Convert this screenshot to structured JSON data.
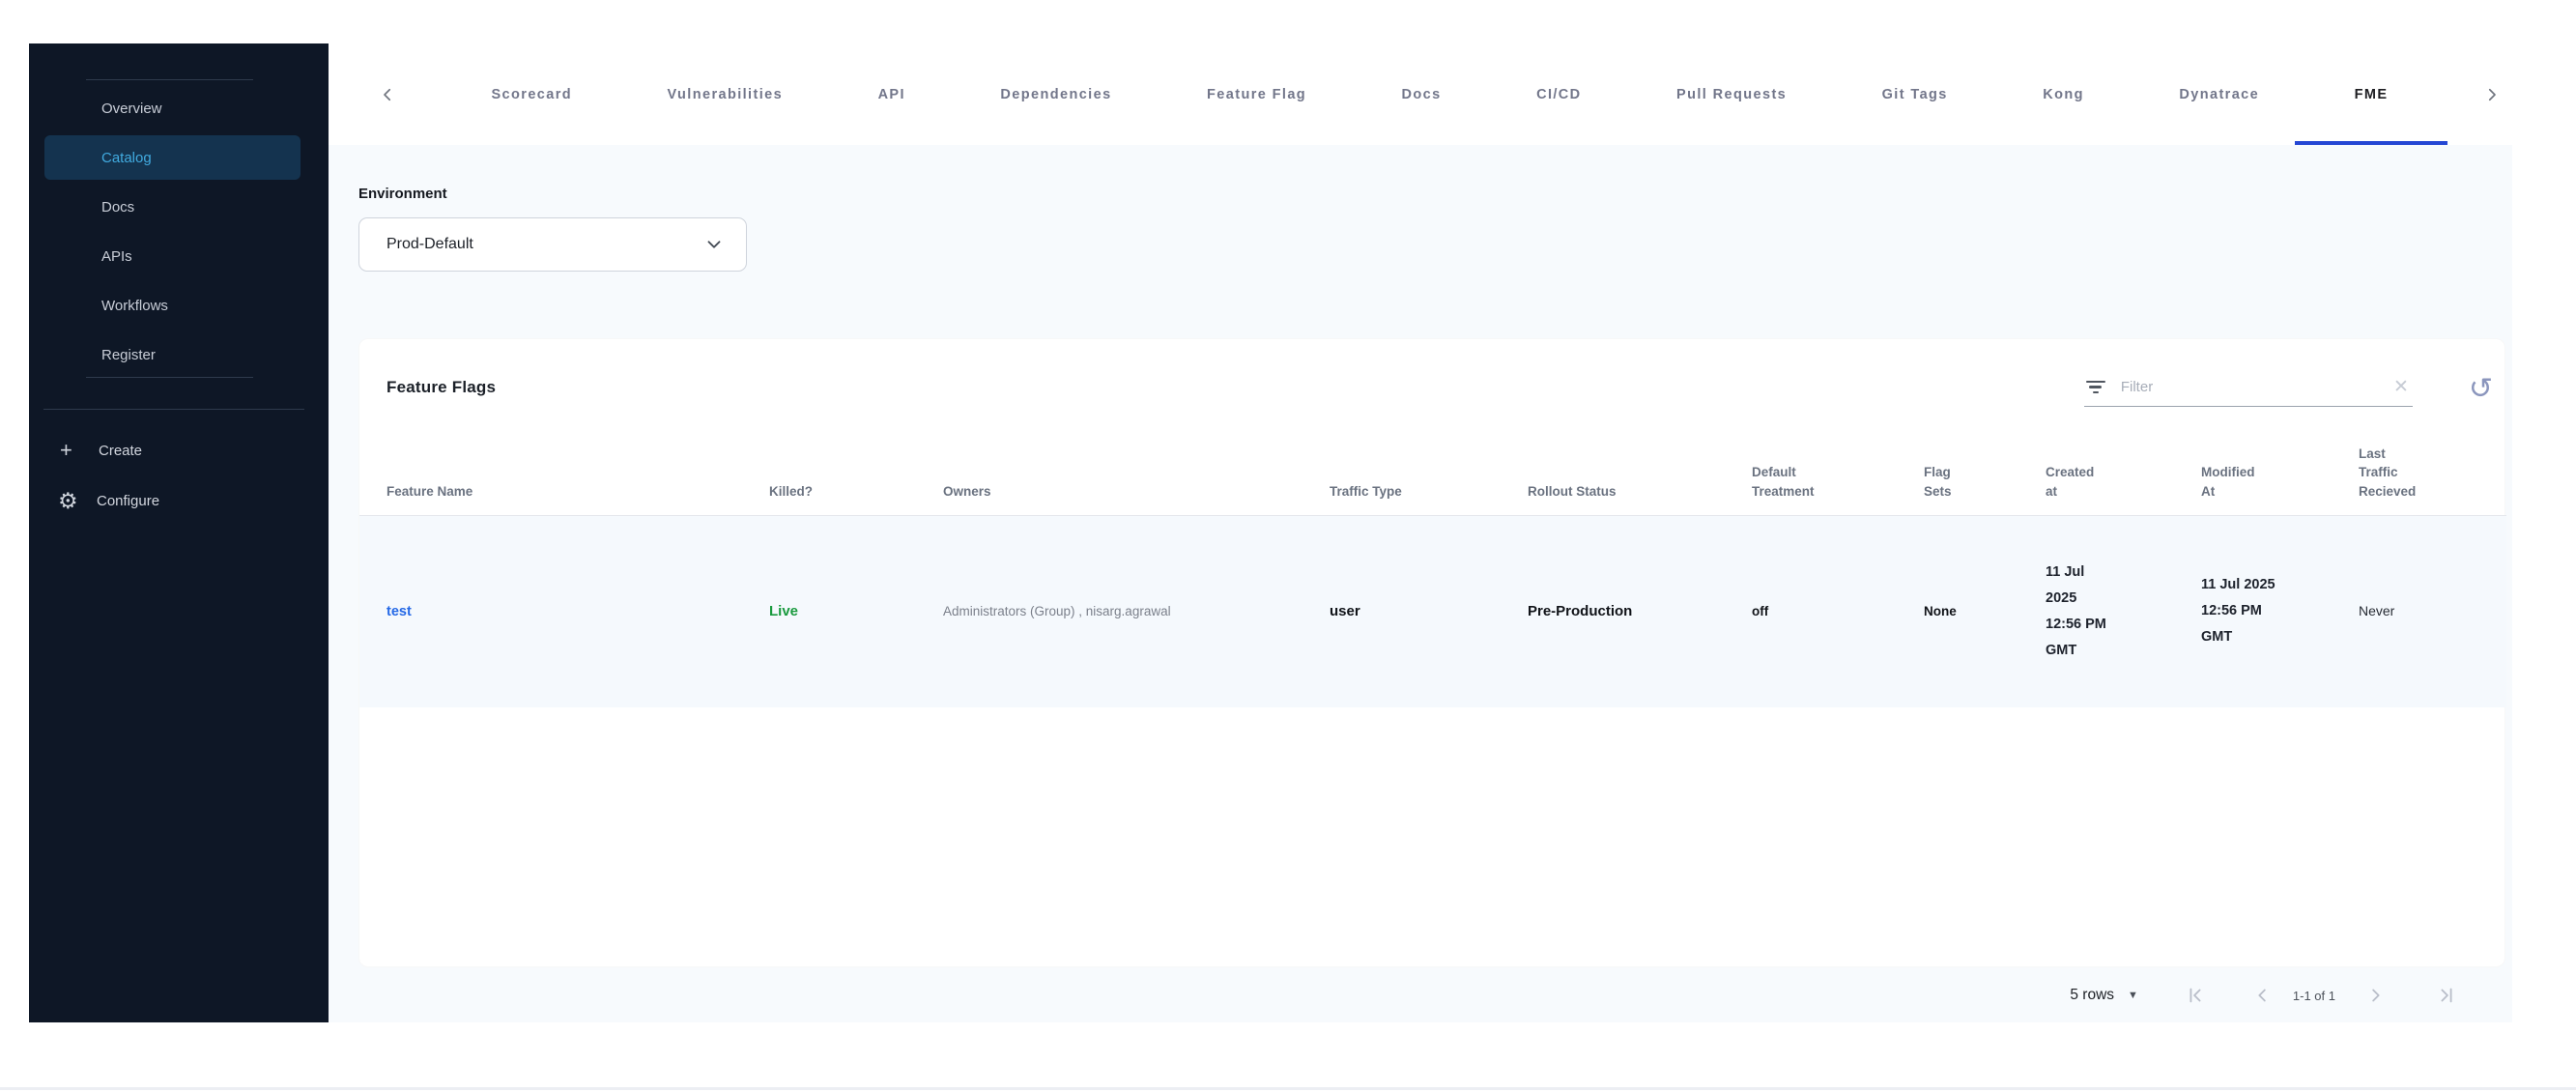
{
  "sidebar": {
    "items": [
      {
        "label": "Overview"
      },
      {
        "label": "Catalog"
      },
      {
        "label": "Docs"
      },
      {
        "label": "APIs"
      },
      {
        "label": "Workflows"
      },
      {
        "label": "Register"
      }
    ],
    "active_item": "Catalog",
    "create_label": "Create",
    "configure_label": "Configure"
  },
  "tabs": {
    "items": [
      {
        "label": "Scorecard"
      },
      {
        "label": "Vulnerabilities"
      },
      {
        "label": "API"
      },
      {
        "label": "Dependencies"
      },
      {
        "label": "Feature Flag"
      },
      {
        "label": "Docs"
      },
      {
        "label": "CI/CD"
      },
      {
        "label": "Pull Requests"
      },
      {
        "label": "Git Tags"
      },
      {
        "label": "Kong"
      },
      {
        "label": "Dynatrace"
      },
      {
        "label": "FME"
      }
    ],
    "active_tab": "FME"
  },
  "environment": {
    "label": "Environment",
    "value": "Prod-Default"
  },
  "card": {
    "title": "Feature Flags",
    "filter_placeholder": "Filter",
    "table": {
      "columns": [
        "Feature Name",
        "Killed?",
        "Owners",
        "Traffic Type",
        "Rollout Status",
        "Default Treatment",
        "Flag Sets",
        "Created at",
        "Modified At",
        "Last Traffic Recieved"
      ],
      "rows": [
        {
          "feature_name": "test",
          "killed": "Live",
          "owners": "Administrators (Group) , nisarg.agrawal",
          "traffic_type": "user",
          "rollout_status": "Pre-Production",
          "default_treatment": "off",
          "flag_sets": "None",
          "created_at": "11 Jul 2025 12:56 PM GMT",
          "modified_at": "11 Jul 2025 12:56 PM GMT",
          "last_traffic_recieved": "Never"
        }
      ]
    }
  },
  "pagination": {
    "rows_per_page": "5 rows",
    "range": "1-1 of 1"
  },
  "icons": {
    "plus": "+",
    "gear": "⚙",
    "clear": "✕",
    "reset": "↺",
    "rows_caret": "▼"
  },
  "colors": {
    "sidebar_bg": "#0e1726",
    "sidebar_active_bg": "#14334f",
    "sidebar_active_text": "#41aadf",
    "tab_active_underline": "#2547d4",
    "link_blue": "#2569e6",
    "live_green": "#199a3e",
    "content_bg": "#f7fafd"
  }
}
